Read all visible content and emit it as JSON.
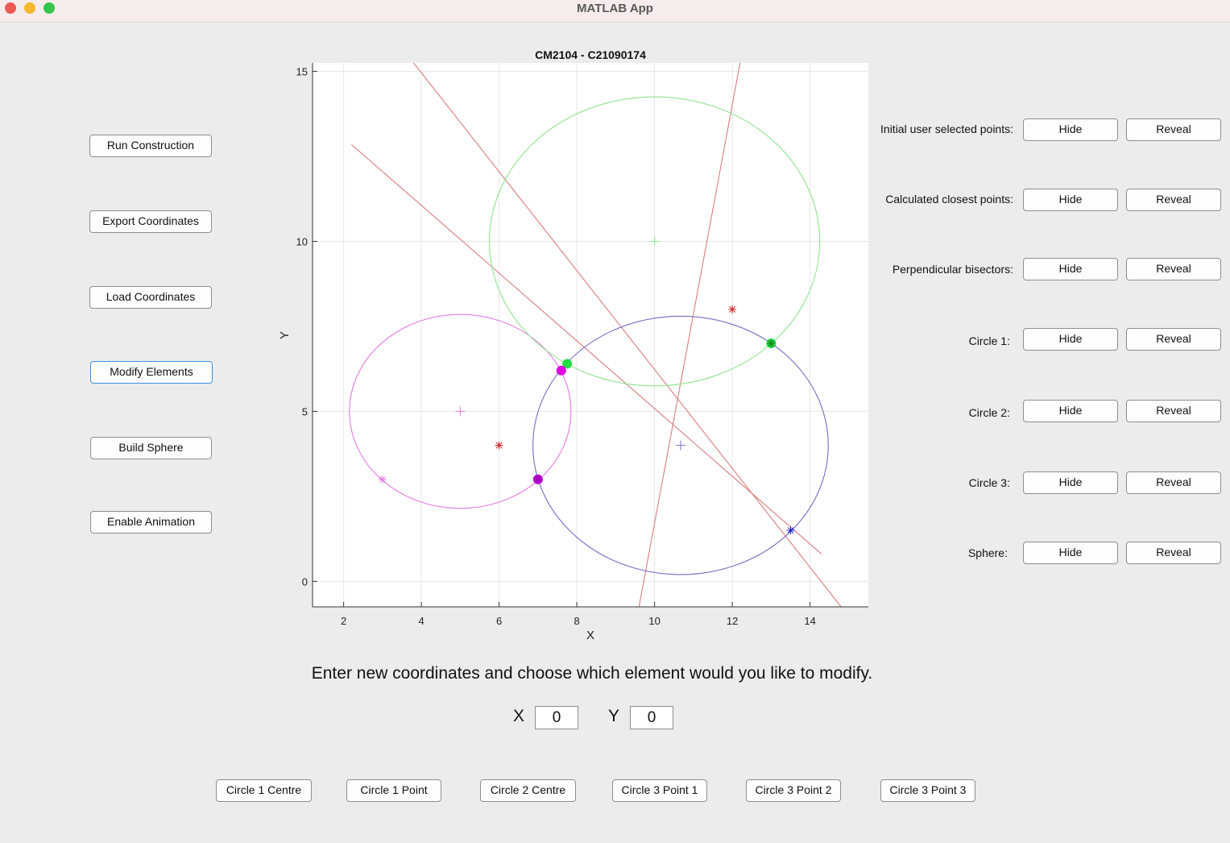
{
  "window": {
    "title": "MATLAB App"
  },
  "left_buttons": [
    {
      "label": "Run Construction"
    },
    {
      "label": "Export Coordinates"
    },
    {
      "label": "Load Coordinates"
    },
    {
      "label": "Modify Elements"
    },
    {
      "label": "Build Sphere"
    },
    {
      "label": "Enable Animation"
    }
  ],
  "visibility_controls": [
    {
      "label": "Initial user selected points:",
      "hide": "Hide",
      "reveal": "Reveal"
    },
    {
      "label": "Calculated closest points:",
      "hide": "Hide",
      "reveal": "Reveal"
    },
    {
      "label": "Perpendicular bisectors:",
      "hide": "Hide",
      "reveal": "Reveal"
    },
    {
      "label": "Circle 1:",
      "hide": "Hide",
      "reveal": "Reveal"
    },
    {
      "label": "Circle 2:",
      "hide": "Hide",
      "reveal": "Reveal"
    },
    {
      "label": "Circle 3:",
      "hide": "Hide",
      "reveal": "Reveal"
    },
    {
      "label": "Sphere:",
      "hide": "Hide",
      "reveal": "Reveal"
    }
  ],
  "modify": {
    "prompt": "Enter new coordinates and choose which element would you like to modify.",
    "x_label": "X",
    "x_value": "0",
    "y_label": "Y",
    "y_value": "0",
    "element_buttons": [
      {
        "label": "Circle 1 Centre"
      },
      {
        "label": "Circle 1 Point"
      },
      {
        "label": "Circle 2 Centre"
      },
      {
        "label": "Circle 3 Point 1"
      },
      {
        "label": "Circle 3 Point 2"
      },
      {
        "label": "Circle 3 Point 3"
      }
    ]
  },
  "colors": {
    "circle_magenta": "#e27ae2",
    "circle_green": "#8fe38f",
    "circle_blue": "#7070c4",
    "bisector": "#d97c7c",
    "point_magenta": "#e000e0",
    "point_green": "#22dd44",
    "point_purple": "#b000c8",
    "star_red": "#cc2222",
    "star_blue": "#2222cc"
  },
  "chart_data": {
    "type": "scatter",
    "title": "CM2104 - C21090174",
    "xlabel": "X",
    "ylabel": "Y",
    "xlim": [
      1.2,
      15.5
    ],
    "ylim": [
      -0.75,
      15.25
    ],
    "xticks": [
      2,
      4,
      6,
      8,
      10,
      12,
      14
    ],
    "yticks": [
      0,
      5,
      10,
      15
    ],
    "grid": true,
    "circles": [
      {
        "name": "Circle 1",
        "center": [
          5,
          5
        ],
        "rx": 2.85,
        "ry": 2.85,
        "color": "#e27ae2"
      },
      {
        "name": "Circle 2",
        "center": [
          10,
          10
        ],
        "rx": 4.25,
        "ry": 4.25,
        "color": "#8fe38f"
      },
      {
        "name": "Circle 3",
        "center": [
          10.67,
          4.0
        ],
        "rx": 3.8,
        "ry": 3.8,
        "color": "#7070c4"
      }
    ],
    "bisectors": [
      [
        [
          2.2,
          12.85
        ],
        [
          14.3,
          0.8
        ]
      ],
      [
        [
          3.8,
          15.25
        ],
        [
          14.8,
          -0.75
        ]
      ],
      [
        [
          9.6,
          -0.75
        ],
        [
          12.2,
          15.25
        ]
      ]
    ],
    "centre_markers": [
      {
        "x": 5,
        "y": 5,
        "color": "#e27ae2"
      },
      {
        "x": 10,
        "y": 10,
        "color": "#8fe38f"
      },
      {
        "x": 10.67,
        "y": 4.0,
        "color": "#7070c4"
      }
    ],
    "star_points": [
      {
        "x": 3,
        "y": 3,
        "color": "#e27ae2"
      },
      {
        "x": 6,
        "y": 4,
        "color": "#cc2222"
      },
      {
        "x": 12,
        "y": 8,
        "color": "#cc2222"
      },
      {
        "x": 13,
        "y": 7,
        "color": "#1a7a1a"
      },
      {
        "x": 13.5,
        "y": 1.5,
        "color": "#2222cc"
      }
    ],
    "filled_points": [
      {
        "x": 7.75,
        "y": 6.4,
        "color": "#22dd44"
      },
      {
        "x": 7.6,
        "y": 6.2,
        "color": "#e000e0"
      },
      {
        "x": 7.0,
        "y": 3.0,
        "color": "#b000c8"
      },
      {
        "x": 13.0,
        "y": 7.0,
        "color": "#22dd44"
      }
    ]
  }
}
